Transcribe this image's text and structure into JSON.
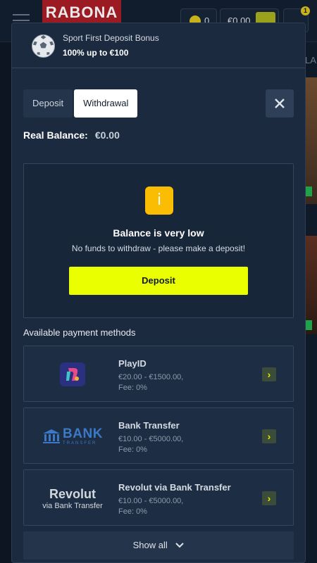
{
  "background": {
    "logo": "RABONA",
    "coins": "0",
    "balance": "€0.00",
    "notification_count": "1",
    "side_text": "LA"
  },
  "bonus": {
    "title": "Sport First Deposit Bonus",
    "subtitle": "100% up to €100",
    "icon": "soccer-ball-icon"
  },
  "tabs": [
    {
      "label": "Deposit",
      "active": false
    },
    {
      "label": "Withdrawal",
      "active": true
    }
  ],
  "balance": {
    "label": "Real Balance:",
    "value": "€0.00"
  },
  "notice": {
    "icon": "info-icon",
    "icon_glyph": "i",
    "title": "Balance is very low",
    "message": "No funds to withdraw - please make a deposit!",
    "button_label": "Deposit"
  },
  "payment_methods": {
    "heading": "Available payment methods",
    "items": [
      {
        "name": "PlayID",
        "range": "€20.00 - €1500.00,",
        "fee": "Fee: 0%",
        "logo": "playid-logo"
      },
      {
        "name": "Bank Transfer",
        "range": "€10.00 - €5000.00,",
        "fee": "Fee: 0%",
        "logo": "bank-transfer-logo",
        "logo_text": "BANK",
        "logo_subtext": "TRANSFER"
      },
      {
        "name": "Revolut via Bank Transfer",
        "range": "€10.00 - €5000.00,",
        "fee": "Fee: 0%",
        "logo": "revolut-logo",
        "logo_text": "Revolut",
        "logo_subtext": "via Bank Transfer"
      }
    ],
    "show_all_label": "Show all"
  },
  "colors": {
    "accent": "#eaff00",
    "warning": "#fbbc04",
    "modal_bg": "#1b2a3e"
  }
}
